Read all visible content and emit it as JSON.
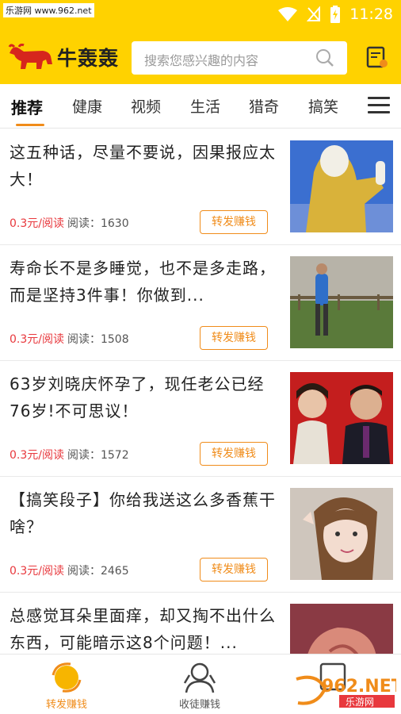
{
  "status": {
    "time": "11:28",
    "watermark": "乐游网 www.962.net"
  },
  "header": {
    "logo_text": "牛轰轰",
    "search_placeholder": "搜索您感兴趣的内容"
  },
  "tabs": [
    "推荐",
    "健康",
    "视频",
    "生活",
    "猎奇",
    "搞笑"
  ],
  "feed": [
    {
      "title": "这五种话，尽量不要说，因果报应太大！",
      "price": "0.3元/阅读",
      "reads": "阅读：1630",
      "button": "转发赚钱"
    },
    {
      "title": "寿命长不是多睡觉，也不是多走路，而是坚持3件事！你做到...",
      "price": "0.3元/阅读",
      "reads": "阅读：1508",
      "button": "转发赚钱"
    },
    {
      "title": "63岁刘晓庆怀孕了，现任老公已经76岁!不可思议！",
      "price": "0.3元/阅读",
      "reads": "阅读：1572",
      "button": "转发赚钱"
    },
    {
      "title": "【搞笑段子】你给我送这么多香蕉干啥？",
      "price": "0.3元/阅读",
      "reads": "阅读：2465",
      "button": "转发赚钱"
    },
    {
      "title": "总感觉耳朵里面痒，却又掏不出什么东西，可能暗示这8个问题！...",
      "price": "",
      "reads": "",
      "button": ""
    }
  ],
  "bottom_nav": [
    {
      "label": "转发赚钱",
      "icon": "coin-refresh-icon",
      "active": true
    },
    {
      "label": "收徒赚钱",
      "icon": "apprentice-icon",
      "active": false
    },
    {
      "label": "",
      "icon": "profile-icon",
      "active": false
    }
  ],
  "colors": {
    "brand_yellow": "#ffd200",
    "accent_orange": "#f08c1a",
    "price_red": "#e8383d"
  },
  "watermark_br": "962.NET 乐游网"
}
